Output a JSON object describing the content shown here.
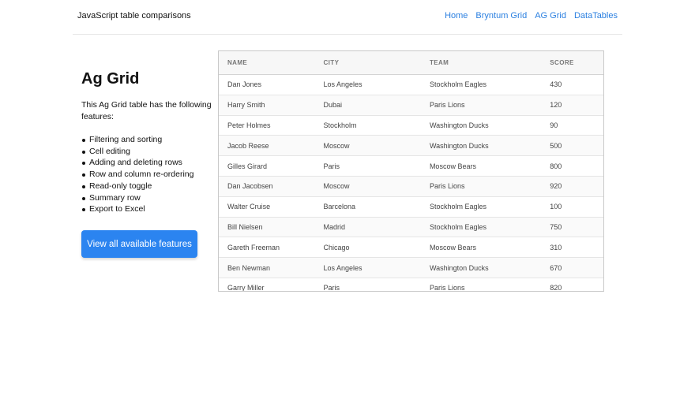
{
  "header": {
    "brand": "JavaScript table comparisons",
    "nav": [
      "Home",
      "Bryntum Grid",
      "AG Grid",
      "DataTables"
    ]
  },
  "side": {
    "title": "Ag Grid",
    "intro": "This Ag Grid table has the following features:",
    "features": [
      "Filtering and sorting",
      "Cell editing",
      "Adding and deleting rows",
      "Row and column re-ordering",
      "Read-only toggle",
      "Summary row",
      "Export to Excel"
    ],
    "cta": "View all available features"
  },
  "grid": {
    "columns": [
      "NAME",
      "CITY",
      "TEAM",
      "SCORE"
    ],
    "rows": [
      [
        "Dan Jones",
        "Los Angeles",
        "Stockholm Eagles",
        "430"
      ],
      [
        "Harry Smith",
        "Dubai",
        "Paris Lions",
        "120"
      ],
      [
        "Peter Holmes",
        "Stockholm",
        "Washington Ducks",
        "90"
      ],
      [
        "Jacob Reese",
        "Moscow",
        "Washington Ducks",
        "500"
      ],
      [
        "Gilles Girard",
        "Paris",
        "Moscow Bears",
        "800"
      ],
      [
        "Dan Jacobsen",
        "Moscow",
        "Paris Lions",
        "920"
      ],
      [
        "Walter Cruise",
        "Barcelona",
        "Stockholm Eagles",
        "100"
      ],
      [
        "Bill Nielsen",
        "Madrid",
        "Stockholm Eagles",
        "750"
      ],
      [
        "Gareth Freeman",
        "Chicago",
        "Moscow Bears",
        "310"
      ],
      [
        "Ben Newman",
        "Los Angeles",
        "Washington Ducks",
        "670"
      ],
      [
        "Garry Miller",
        "Paris",
        "Paris Lions",
        "820"
      ]
    ]
  },
  "colors": {
    "link": "#2a7fe0",
    "button": "#2b84f0"
  }
}
